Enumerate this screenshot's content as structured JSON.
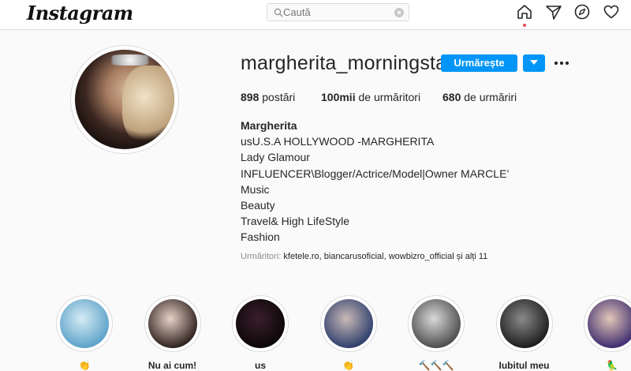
{
  "topbar": {
    "logo": "Instagram",
    "search_placeholder": "Caută",
    "icons": [
      "home-icon",
      "direct-icon",
      "explore-icon",
      "activity-icon"
    ]
  },
  "profile": {
    "username": "margherita_morningstar",
    "follow_label": "Urmărește",
    "stats": {
      "posts_count": "898",
      "posts_label": "postări",
      "followers_count": "100mii",
      "followers_label": "de urmăritori",
      "following_count": "680",
      "following_label": "de urmăriri"
    },
    "bio": {
      "name": "Margherita",
      "lines": [
        "usU.S.A HOLLYWOOD -MARGHERITA",
        "Lady Glamour",
        "INFLUENCER\\Blogger/Actrice/Model|Owner MARCLE’",
        "Music",
        "Beauty",
        "Travel& High LifeStyle",
        "Fashion"
      ]
    },
    "followed_by": {
      "prefix": "Urmăritori:",
      "names": "kfetele.ro, biancarusoficial, wowbizro_official",
      "suffix": "și alți 11"
    }
  },
  "highlights": [
    {
      "label": "👏",
      "colors": [
        "#d6ecf5",
        "#5aa0c8"
      ]
    },
    {
      "label": "Nu ai cum!",
      "colors": [
        "#e8d2c8",
        "#2a1d1a"
      ]
    },
    {
      "label": "us",
      "colors": [
        "#3a1e2a",
        "#0a0608"
      ]
    },
    {
      "label": "👏",
      "colors": [
        "#c9b9b6",
        "#2b3c6b"
      ]
    },
    {
      "label": "🔨🔨🔨",
      "colors": [
        "#d9d9d9",
        "#4a4a4a"
      ]
    },
    {
      "label": "Iubitul meu",
      "colors": [
        "#8a8a8a",
        "#1b1b1b"
      ]
    },
    {
      "label": "🦜",
      "colors": [
        "#e3c6b8",
        "#3b2a6e"
      ]
    }
  ]
}
